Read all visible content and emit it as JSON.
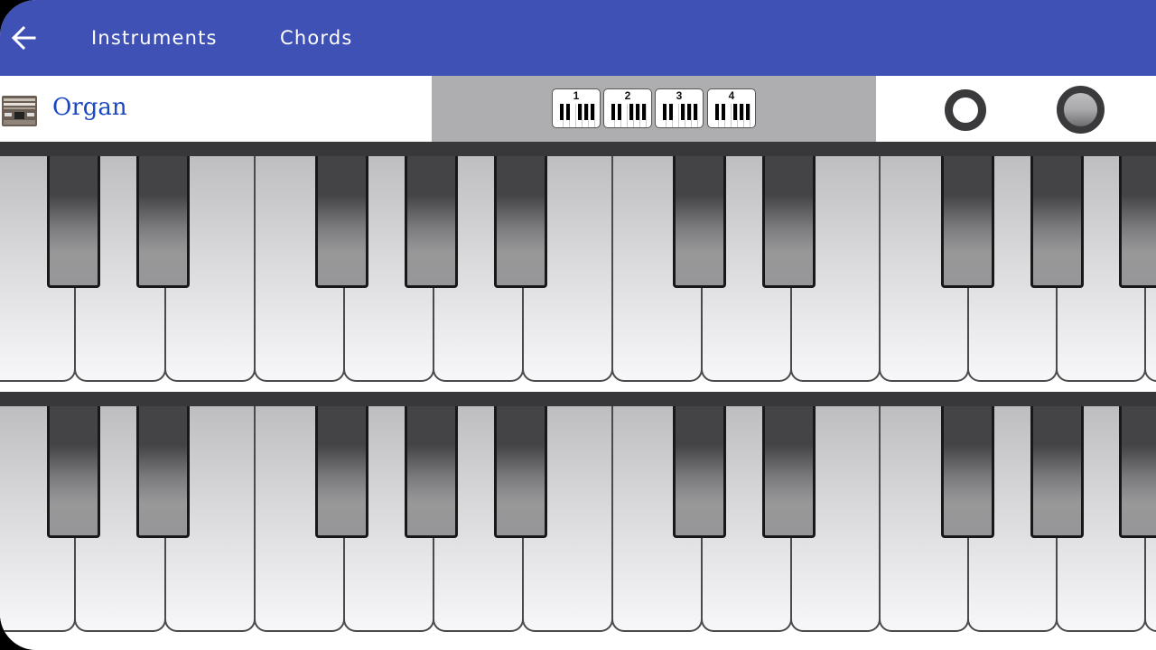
{
  "topbar": {
    "back_icon": "arrow-left-icon",
    "tabs": [
      {
        "label": "Instruments"
      },
      {
        "label": "Chords"
      }
    ],
    "background_color": "#3f51b5"
  },
  "instrument": {
    "icon": "organ-thumbnail-icon",
    "name": "Organ",
    "name_color": "#1a47c2"
  },
  "octave_selector": {
    "options": [
      {
        "label": "1"
      },
      {
        "label": "2"
      },
      {
        "label": "3"
      },
      {
        "label": "4"
      }
    ]
  },
  "controls": [
    {
      "name": "record-button"
    },
    {
      "name": "play-button"
    }
  ],
  "keyboards": [
    {
      "name": "upper-keyboard",
      "white_keys": 14,
      "black_keys": 10
    },
    {
      "name": "lower-keyboard",
      "white_keys": 14,
      "black_keys": 10
    }
  ]
}
